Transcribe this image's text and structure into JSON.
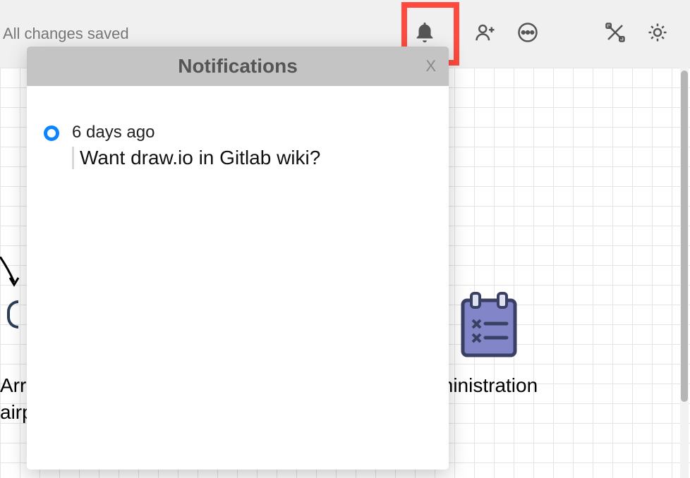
{
  "toolbar": {
    "saveStatus": "All changes saved"
  },
  "notifications": {
    "title": "Notifications",
    "closeLabel": "X",
    "items": [
      {
        "time": "6 days ago",
        "title": "Want draw.io in Gitlab wiki?"
      }
    ]
  },
  "canvas": {
    "leftLabelPartial": "Arr\nairp",
    "rightLabelPartial": "ministration"
  }
}
